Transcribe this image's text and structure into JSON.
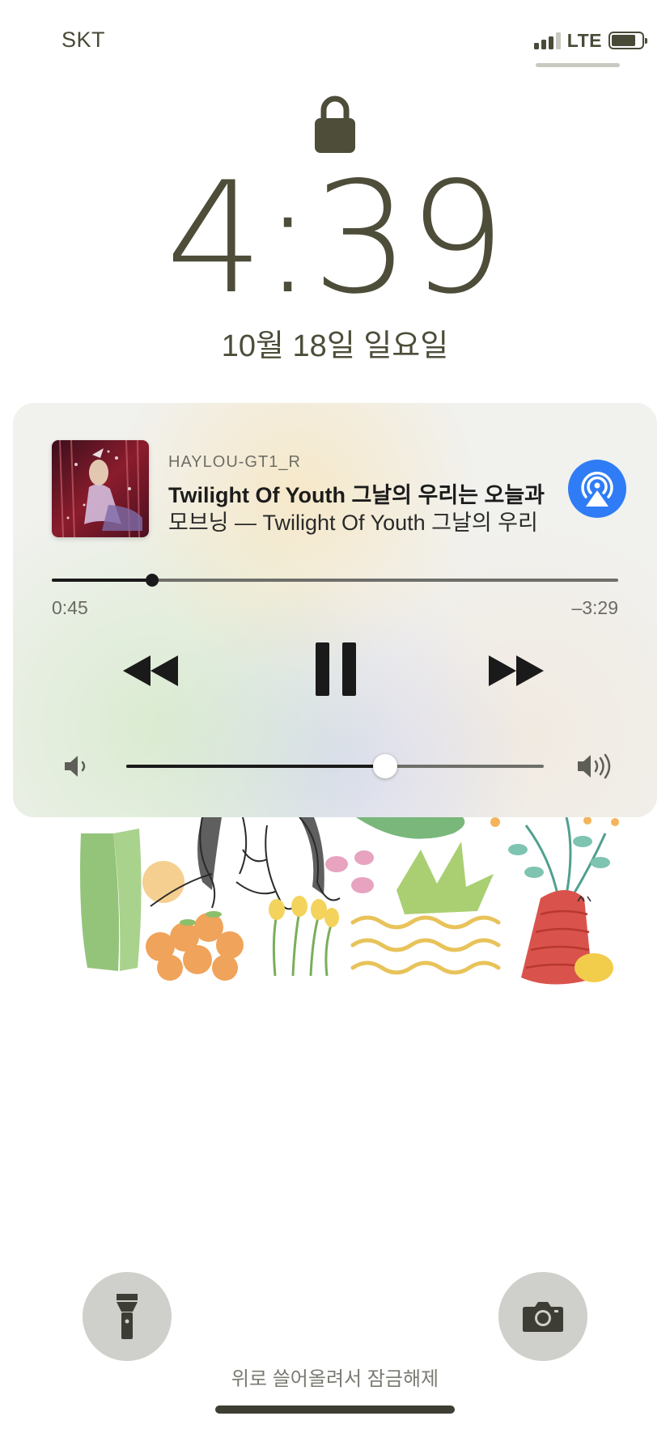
{
  "status_bar": {
    "carrier": "SKT",
    "network": "LTE",
    "signal_bars_active": 3,
    "signal_bars_total": 4,
    "battery_level": 0.8
  },
  "lock_screen": {
    "time": "4:39",
    "date": "10월 18일 일요일",
    "unlock_hint": "위로 쓸어올려서 잠금해제"
  },
  "now_playing": {
    "output_device": "HAYLOU-GT1_R",
    "title": "Twilight Of Youth 그날의 우리는 오늘과",
    "subtitle": "모브닝 — Twilight Of Youth 그날의 우리",
    "elapsed": "0:45",
    "remaining": "–3:29",
    "progress": 0.177,
    "volume": 0.62
  },
  "icons": {
    "lock": "lock-icon",
    "airplay": "airplay-audio-icon",
    "rewind": "rewind-icon",
    "pause": "pause-icon",
    "forward": "fast-forward-icon",
    "volume_low": "speaker-low-icon",
    "volume_high": "speaker-high-icon",
    "flashlight": "flashlight-icon",
    "camera": "camera-icon"
  },
  "colors": {
    "text_primary": "#4d4d39",
    "airplay_accent": "#2f7cf6",
    "round_button_bg": "#cfcfcb"
  }
}
